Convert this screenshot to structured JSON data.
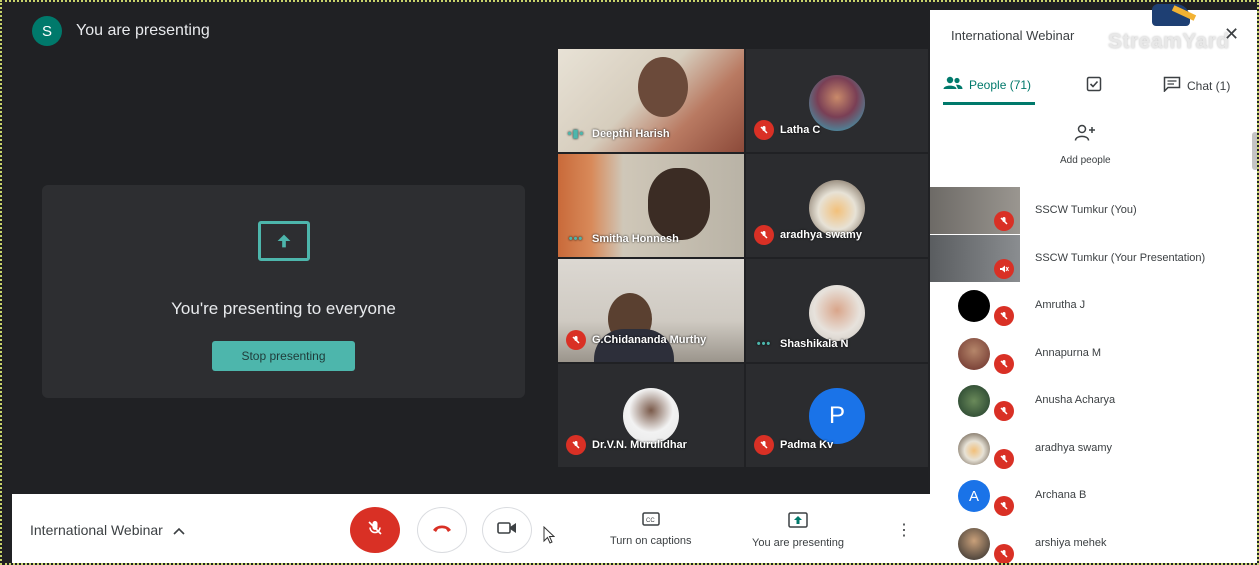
{
  "presenting": {
    "avatar_letter": "S",
    "label": "You are presenting"
  },
  "presentation_card": {
    "message": "You're presenting to everyone",
    "stop_label": "Stop presenting"
  },
  "participants": [
    {
      "name": "Deepthi Harish",
      "status": "speaking"
    },
    {
      "name": "Latha C",
      "status": "muted"
    },
    {
      "name": "Smitha Honnesh",
      "status": "speaking"
    },
    {
      "name": "aradhya swamy",
      "status": "muted"
    },
    {
      "name": "G.Chidananda Murthy",
      "status": "muted"
    },
    {
      "name": "Shashikala N",
      "status": "speaking"
    },
    {
      "name": "Dr.V.N. Murulidhar",
      "status": "muted"
    },
    {
      "name": "Padma Kv",
      "status": "muted",
      "avatar_letter": "P"
    }
  ],
  "control_bar": {
    "meeting_title": "International Webinar",
    "captions_label": "Turn on captions",
    "present_label": "You are presenting",
    "colors": {
      "mic_off": "#d93025",
      "hangup": "#d93025"
    }
  },
  "side_panel": {
    "title": "International Webinar",
    "logo_text": "StreamYard",
    "tabs": {
      "people": "People (71)",
      "chat": "Chat (1)"
    },
    "add_people_label": "Add people",
    "people": [
      {
        "name": "SSCW Tumkur (You)",
        "kind": "video"
      },
      {
        "name": "SSCW Tumkur (Your Presentation)",
        "kind": "video"
      },
      {
        "name": "Amrutha J",
        "kind": "avatar"
      },
      {
        "name": "Annapurna M",
        "kind": "avatar"
      },
      {
        "name": "Anusha Acharya",
        "kind": "avatar"
      },
      {
        "name": "aradhya swamy",
        "kind": "avatar"
      },
      {
        "name": "Archana B",
        "kind": "letter",
        "letter": "A"
      },
      {
        "name": "arshiya mehek",
        "kind": "avatar"
      }
    ]
  },
  "accent_color": "#4db6ac"
}
